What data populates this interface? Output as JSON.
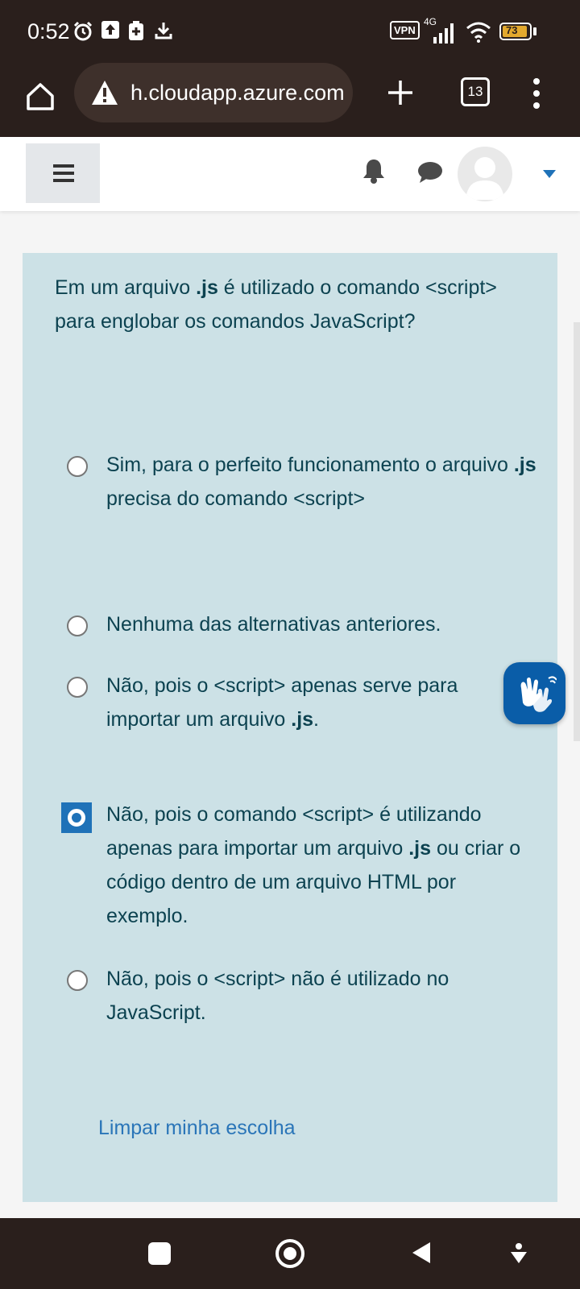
{
  "status_bar": {
    "time": "0:52",
    "vpn_label": "VPN",
    "network": "4G",
    "battery": "73"
  },
  "browser": {
    "url": "h.cloudapp.azure.com",
    "tab_count": "13"
  },
  "question": {
    "text_parts": [
      "Em um arquivo ",
      ".js",
      " é utilizado o comando <script> para englobar os comandos JavaScript?"
    ],
    "options": [
      {
        "parts": [
          "Sim, para o perfeito funcionamento o arquivo ",
          ".js",
          " precisa do comando <script>"
        ],
        "selected": false
      },
      {
        "parts": [
          "Nenhuma das alternativas anteriores.",
          "",
          ""
        ],
        "selected": false
      },
      {
        "parts": [
          "Não, pois o <script> apenas serve para importar um arquivo ",
          ".js",
          "."
        ],
        "selected": false
      },
      {
        "parts": [
          "Não, pois o comando <script> é utilizando apenas para importar um arquivo ",
          ".js",
          " ou criar o código dentro de um arquivo HTML por exemplo."
        ],
        "selected": true
      },
      {
        "parts": [
          "Não, pois o <script> não é utilizado no JavaScript.",
          "",
          ""
        ],
        "selected": false
      }
    ],
    "clear_label": "Limpar minha escolha"
  },
  "colors": {
    "card_bg": "#cce1e6",
    "text": "#0c4250",
    "accent": "#1f72b8",
    "link": "#2a75b8"
  }
}
